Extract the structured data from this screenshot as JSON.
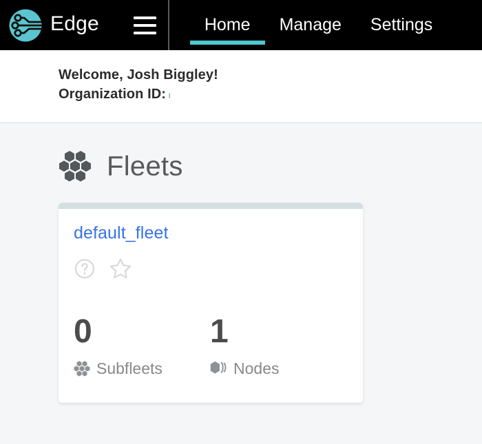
{
  "topnav": {
    "brand_name": "Edge",
    "logo_icon": "edge-circuit-logo-icon",
    "menu_icon": "hamburger-menu-icon",
    "accent_color": "#4ec8d0",
    "background_color": "#000000",
    "tabs": [
      {
        "label": "Home",
        "active": true
      },
      {
        "label": "Manage",
        "active": false
      },
      {
        "label": "Settings",
        "active": false
      }
    ]
  },
  "welcome": {
    "greeting": "Welcome, Josh Biggley!",
    "org_id_label": "Organization ID:",
    "org_id_value": "l"
  },
  "fleets_section": {
    "title": "Fleets",
    "icon": "hexagon-cluster-icon"
  },
  "fleet_card": {
    "name": "default_fleet",
    "topbar_color": "#d5dfe2",
    "link_color": "#3673e8",
    "help_icon": "help-circle-icon",
    "favorite_icon": "star-outline-icon",
    "stats": [
      {
        "value": "0",
        "label": "Subfleets",
        "icon": "hexagon-cluster-icon"
      },
      {
        "value": "1",
        "label": "Nodes",
        "icon": "hexagon-stack-icon"
      }
    ]
  }
}
